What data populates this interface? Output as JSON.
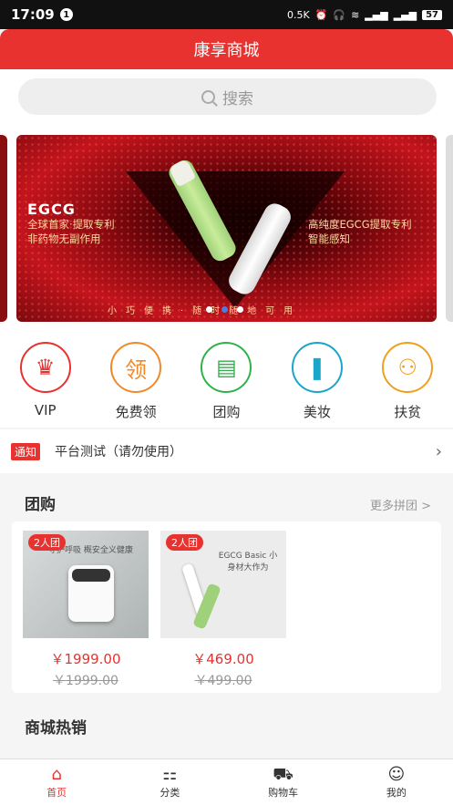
{
  "status_bar": {
    "time": "17:09",
    "notif_count": "1",
    "speed": "0.5K",
    "battery": "57"
  },
  "header": {
    "title": "康享商城"
  },
  "search": {
    "placeholder": "搜索"
  },
  "banner": {
    "brand": "EGCG",
    "line1": "全球首家·提取专利",
    "line2": "非药物无副作用",
    "right1": "高纯度EGCG提取专利",
    "right2": "智能感知",
    "bottom": "小巧便携·随时随地可用"
  },
  "categories": [
    {
      "label": "VIP",
      "icon": "crown-icon",
      "color": "#e8322f",
      "glyph": "♛"
    },
    {
      "label": "免费领",
      "icon": "ling-icon",
      "color": "#ef8a2c",
      "glyph": "领"
    },
    {
      "label": "团购",
      "icon": "group-buy-icon",
      "color": "#2fb24a",
      "glyph": "▤"
    },
    {
      "label": "美妆",
      "icon": "lipstick-icon",
      "color": "#1aa6c8",
      "glyph": "❚"
    },
    {
      "label": "扶贫",
      "icon": "people-icon",
      "color": "#f0a020",
      "glyph": "⚇"
    }
  ],
  "notice": {
    "tag": "通知",
    "text": "平台测试（请勿使用）"
  },
  "group_buy": {
    "title": "团购",
    "more": "更多拼团 >",
    "products": [
      {
        "badge": "2人团",
        "price": "￥1999.00",
        "original": "￥1999.00",
        "img_caption": "守护呼吸 概安全义健康"
      },
      {
        "badge": "2人团",
        "price": "￥469.00",
        "original": "￥499.00",
        "img_caption": "EGCG Basic 小身材大作为"
      }
    ]
  },
  "hot": {
    "title": "商城热销"
  },
  "tabbar": [
    {
      "label": "首页",
      "icon": "home-icon",
      "active": true
    },
    {
      "label": "分类",
      "icon": "category-icon",
      "active": false
    },
    {
      "label": "购物车",
      "icon": "cart-icon",
      "active": false
    },
    {
      "label": "我的",
      "icon": "user-icon",
      "active": false
    }
  ]
}
